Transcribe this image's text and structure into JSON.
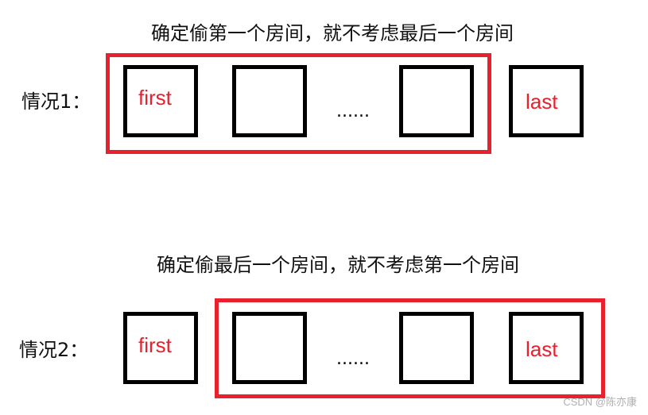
{
  "case1": {
    "caption": "确定偷第一个房间，就不考虑最后一个房间",
    "label": "情况1：",
    "rooms": [
      {
        "text": "first",
        "highlighted": true
      },
      {
        "text": ""
      },
      {
        "text": ""
      },
      {
        "text": "last",
        "highlighted": false
      }
    ],
    "ellipsis": "......"
  },
  "case2": {
    "caption": "确定偷最后一个房间，就不考虑第一个房间",
    "label": "情况2：",
    "rooms": [
      {
        "text": "first",
        "highlighted": false
      },
      {
        "text": ""
      },
      {
        "text": ""
      },
      {
        "text": "last",
        "highlighted": true
      }
    ],
    "ellipsis": "......"
  },
  "colors": {
    "highlight": "#e8212f",
    "room_border": "#000000"
  },
  "watermark": "CSDN @陈亦康"
}
